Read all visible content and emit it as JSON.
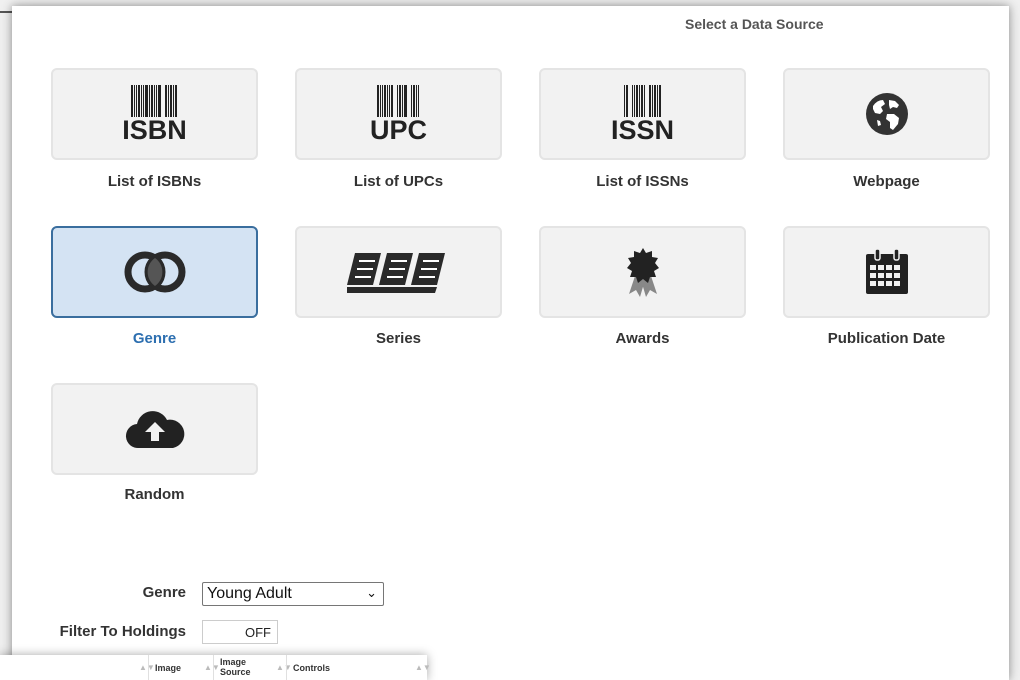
{
  "header": {
    "title": "Select a Data Source"
  },
  "tiles": [
    {
      "label": "List of ISBNs",
      "icon": "isbn-barcode-icon",
      "code": "ISBN"
    },
    {
      "label": "List of UPCs",
      "icon": "upc-barcode-icon",
      "code": "UPC"
    },
    {
      "label": "List of ISSNs",
      "icon": "issn-barcode-icon",
      "code": "ISSN"
    },
    {
      "label": "Webpage",
      "icon": "globe-icon"
    },
    {
      "label": "Genre",
      "icon": "venn-circles-icon",
      "selected": true
    },
    {
      "label": "Series",
      "icon": "books-icon"
    },
    {
      "label": "Awards",
      "icon": "award-ribbon-icon"
    },
    {
      "label": "Publication Date",
      "icon": "calendar-icon"
    },
    {
      "label": "Random",
      "icon": "cloud-upload-icon"
    }
  ],
  "form": {
    "genre_label": "Genre",
    "genre_value": "Young Adult",
    "filter_label": "Filter To Holdings",
    "filter_state": "OFF"
  },
  "table": {
    "columns": [
      "Image",
      "Image Source",
      "Controls"
    ]
  },
  "colors": {
    "selected_bg": "#d4e3f3",
    "selected_border": "#3a6e9e",
    "selected_text": "#2d6fb0"
  }
}
